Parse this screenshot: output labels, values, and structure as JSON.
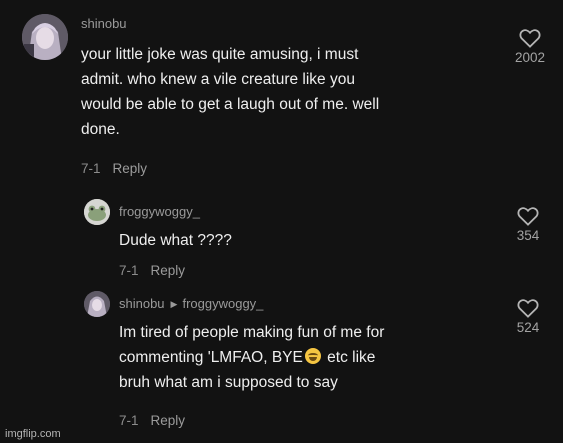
{
  "comments": [
    {
      "username": "shinobu",
      "text_lines": [
        "your little joke was quite amusing, i must",
        "admit. who knew a vile creature like you",
        "would be able to get a laugh out of me. well",
        "done."
      ],
      "date": "7-1",
      "reply_label": "Reply",
      "likes": "2002",
      "avatar_icon": "anime-avatar-icon"
    },
    {
      "username": "froggywoggy_",
      "text_lines": [
        "Dude what ????"
      ],
      "date": "7-1",
      "reply_label": "Reply",
      "likes": "354",
      "avatar_icon": "frog-avatar-icon"
    },
    {
      "username": "shinobu",
      "reply_to": "froggywoggy_",
      "text_lines": [
        "Im tired of people making fun of me for",
        "bruh what am i supposed to say"
      ],
      "line2_before": "commenting 'LMFAO, BYE",
      "line2_after": " etc like",
      "emoji": "crying-laughing-emoji",
      "date": "7-1",
      "reply_label": "Reply",
      "likes": "524",
      "avatar_icon": "anime-avatar-icon"
    }
  ],
  "watermark": "imgflip.com",
  "colors": {
    "background": "#121212",
    "text": "#efefef",
    "muted": "#9a9a9a"
  }
}
